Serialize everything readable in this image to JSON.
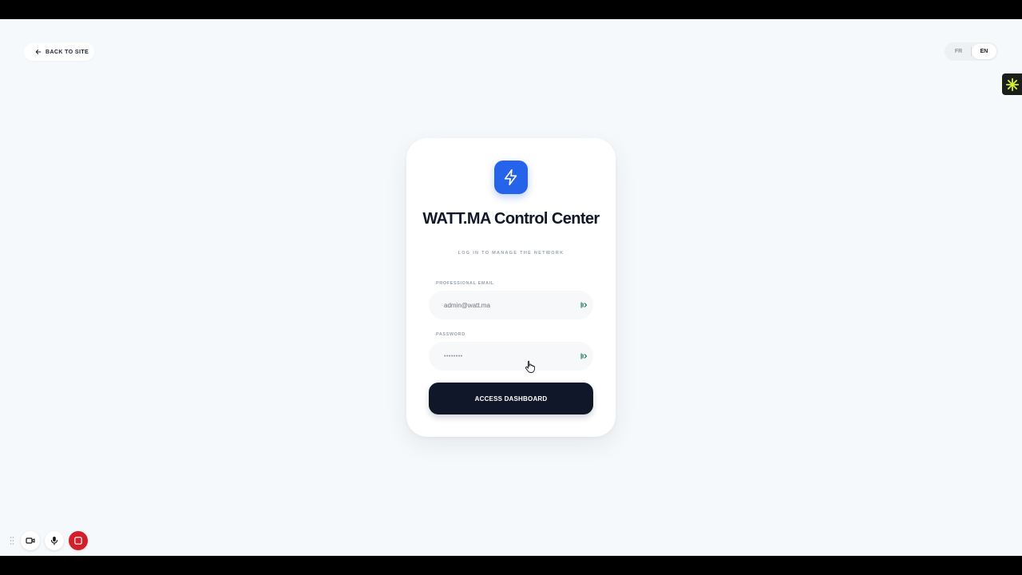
{
  "nav": {
    "back_label": "BACK TO SITE"
  },
  "language": {
    "options": [
      "FR",
      "EN"
    ],
    "selected": "EN"
  },
  "login": {
    "title": "WATT.MA Control Center",
    "subtitle": "LOG IN TO MANAGE THE NETWORK",
    "email_label": "PROFESSIONAL EMAIL",
    "email_value": "admin@watt.ma",
    "password_label": "PASSWORD",
    "password_value": "••••••••",
    "submit_label": "ACCESS DASHBOARD"
  },
  "colors": {
    "accent": "#2563eb",
    "dark": "#0f1729",
    "background": "#f6f9fb",
    "recorder_stop": "#d2202b"
  },
  "icons": {
    "back": "arrow-left-icon",
    "logo": "lightning-bolt-icon",
    "field_addon": "password-manager-icon",
    "extension": "extension-sparkle-icon",
    "recorder": [
      "drag-handle-icon",
      "camera-icon",
      "microphone-icon",
      "stop-icon"
    ]
  }
}
